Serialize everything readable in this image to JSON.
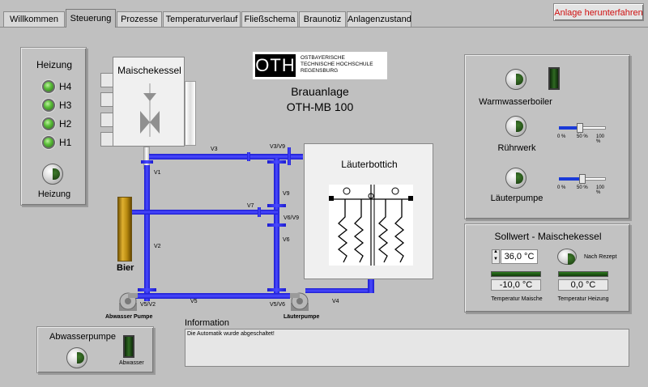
{
  "tabs": [
    {
      "label": "Willkommen"
    },
    {
      "label": "Steuerung"
    },
    {
      "label": "Prozesse"
    },
    {
      "label": "Temperaturverlauf"
    },
    {
      "label": "Fließschema"
    },
    {
      "label": "Braunotiz"
    },
    {
      "label": "Anlagenzustand"
    }
  ],
  "active_tab": "Steuerung",
  "shutdown_label": "Anlage herunterfahren",
  "heating": {
    "title": "Heizung",
    "leds": [
      {
        "label": "H4"
      },
      {
        "label": "H3"
      },
      {
        "label": "H2"
      },
      {
        "label": "H1"
      }
    ],
    "button_label": "Heizung"
  },
  "mash_kettle": {
    "title": "Maischekessel"
  },
  "logo": {
    "letters": "OTH",
    "line1": "OSTBAYERISCHE",
    "line2": "TECHNISCHE HOCHSCHULE",
    "line3": "REGENSBURG"
  },
  "plant": {
    "line1": "Brauanlage",
    "line2": "OTH-MB 100"
  },
  "lauter_tun": {
    "title": "Läuterbottich"
  },
  "beer_label": "Bier",
  "pipe_labels": {
    "v1": "V1",
    "v2": "V2",
    "v3": "V3",
    "v3v9": "V3/V9",
    "v4": "V4",
    "v5": "V5",
    "v5v2": "V5/V2",
    "v5v6": "V5/V6",
    "v6": "V6",
    "v6v9": "V6/V9",
    "v7": "V7",
    "v9": "V9"
  },
  "pumps": {
    "waste": "Abwasser Pumpe",
    "lauter": "Läuterpumpe"
  },
  "right_controls": {
    "boiler_label": "Warmwasserboiler",
    "stirrer_label": "Rührwerk",
    "lauter_pump_label": "Läuterpumpe",
    "stirrer_slider": {
      "value_percent": 45,
      "ticks": [
        "0 %",
        "50 %",
        "100 %"
      ]
    },
    "lauter_slider": {
      "value_percent": 50,
      "ticks": [
        "0 %",
        "50 %",
        "100 %"
      ]
    }
  },
  "setpoint": {
    "title": "Sollwert - Maischekessel",
    "value": "36,0 °C",
    "recipe_label": "Nach Rezept",
    "temp_mash_value": "-10,0 °C",
    "temp_mash_label": "Temperatur Maische",
    "temp_heat_value": "0,0 °C",
    "temp_heat_label": "Temperatur Heizung"
  },
  "information": {
    "label": "Information",
    "text": "Die Automatik wurde abgeschaltet!"
  },
  "waste_pump": {
    "title": "Abwasserpumpe",
    "indicator_label": "Abwasser"
  },
  "colors": {
    "pipe": "#2a2aee",
    "shutdown_text": "#d01010",
    "led_green": "#5cc03a"
  }
}
